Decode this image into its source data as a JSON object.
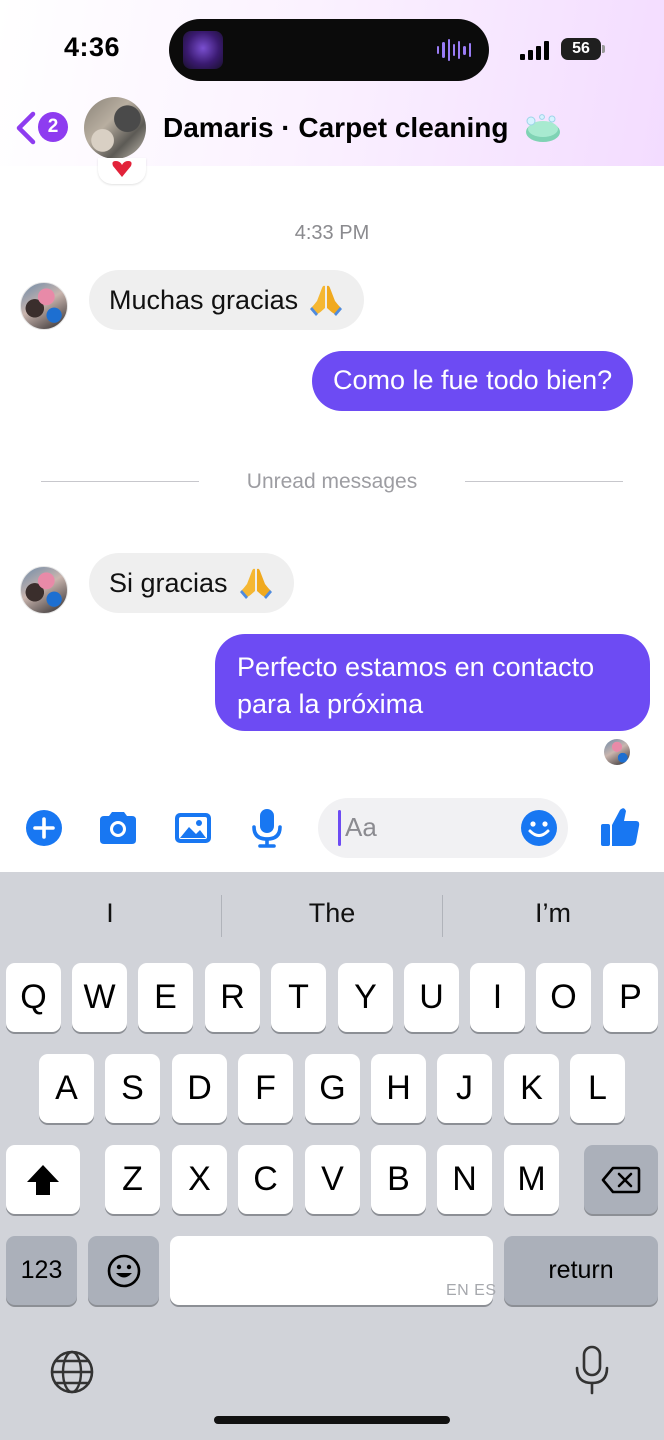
{
  "status_bar": {
    "time": "4:36",
    "battery": "56"
  },
  "header": {
    "back_badge": "2",
    "title": "Damaris · Carpet cleaning"
  },
  "conversation": {
    "timestamp": "4:33 PM",
    "messages": [
      {
        "from": "them",
        "text": "Muchas gracias"
      },
      {
        "from": "me",
        "text": "Como le fue todo bien?"
      },
      {
        "from": "them",
        "text": "Si gracias"
      },
      {
        "from": "me",
        "text": "Perfecto estamos en contacto para la próxima"
      }
    ],
    "unread_divider": "Unread messages"
  },
  "composer": {
    "placeholder": "Aa"
  },
  "keyboard": {
    "suggestions": [
      "I",
      "The",
      "I’m"
    ],
    "row1": [
      "Q",
      "W",
      "E",
      "R",
      "T",
      "Y",
      "U",
      "I",
      "O",
      "P"
    ],
    "row2": [
      "A",
      "S",
      "D",
      "F",
      "G",
      "H",
      "J",
      "K",
      "L"
    ],
    "row3": [
      "Z",
      "X",
      "C",
      "V",
      "B",
      "N",
      "M"
    ],
    "numbers_label": "123",
    "return_label": "return",
    "space_hint": "EN ES"
  },
  "icons": {
    "accent_color": "#6d4bf3",
    "composer_icon_color": "#1877f2"
  }
}
